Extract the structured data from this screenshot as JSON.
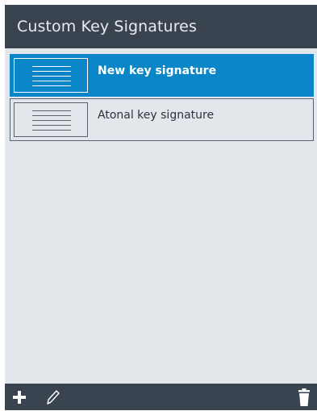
{
  "header": {
    "title": "Custom Key Signatures"
  },
  "list": {
    "items": [
      {
        "label": "New key signature",
        "selected": true
      },
      {
        "label": "Atonal key signature",
        "selected": false
      }
    ]
  },
  "toolbar": {
    "add_icon": "plus-icon",
    "edit_icon": "pencil-icon",
    "delete_icon": "trash-icon"
  },
  "colors": {
    "header_bg": "#3a4350",
    "panel_bg": "#e3e7ec",
    "selection": "#0a86c8",
    "border": "#5a6470"
  }
}
